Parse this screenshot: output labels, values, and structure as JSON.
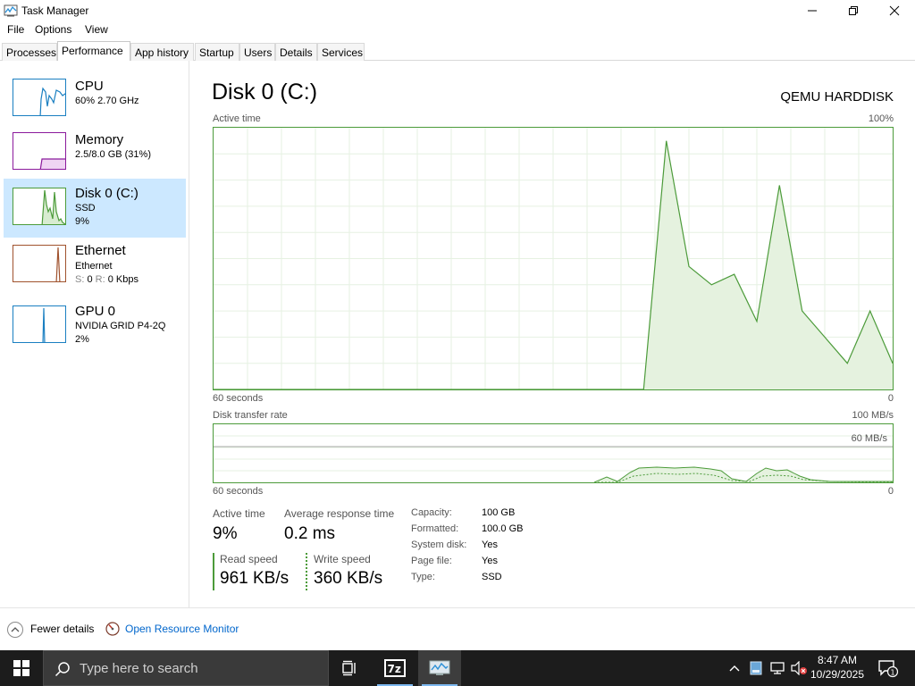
{
  "window": {
    "title": "Task Manager",
    "icon": "task-manager-icon"
  },
  "menu": [
    "File",
    "Options",
    "View"
  ],
  "tabs": [
    "Processes",
    "Performance",
    "App history",
    "Startup",
    "Users",
    "Details",
    "Services"
  ],
  "active_tab": "Performance",
  "sidebar": [
    {
      "name": "CPU",
      "sub1": "60% 2.70 GHz",
      "sub2": "",
      "color": "#1a7fc1"
    },
    {
      "name": "Memory",
      "sub1": "2.5/8.0 GB (31%)",
      "sub2": "",
      "color": "#8b1a9c"
    },
    {
      "name": "Disk 0 (C:)",
      "sub1": "SSD",
      "sub2": "9%",
      "color": "#4c9b3a"
    },
    {
      "name": "Ethernet",
      "sub1": "Ethernet",
      "sub2_dim": "S:",
      "sub2_a": " 0 ",
      "sub2_dim2": "R:",
      "sub2_b": " 0 Kbps",
      "color": "#a0522d"
    },
    {
      "name": "GPU 0",
      "sub1": "NVIDIA GRID P4-2Q",
      "sub2": "2%",
      "color": "#1a7fc1"
    }
  ],
  "selected_item": "Disk 0 (C:)",
  "main": {
    "title": "Disk 0 (C:)",
    "device": "QEMU HARDDISK",
    "graph1_label": "Active time",
    "graph1_max": "100%",
    "graph1_time": "60 seconds",
    "graph1_min": "0",
    "graph2_label": "Disk transfer rate",
    "graph2_max": "100 MB/s",
    "graph2_mid": "60 MB/s",
    "graph2_time": "60 seconds",
    "graph2_min": "0"
  },
  "stats": {
    "active_time_label": "Active time",
    "active_time_value": "9%",
    "avg_resp_label": "Average response time",
    "avg_resp_value": "0.2 ms",
    "read_label": "Read speed",
    "read_value": "961 KB/s",
    "write_label": "Write speed",
    "write_value": "360 KB/s"
  },
  "info": [
    {
      "k": "Capacity:",
      "v": "100 GB"
    },
    {
      "k": "Formatted:",
      "v": "100.0 GB"
    },
    {
      "k": "System disk:",
      "v": "Yes"
    },
    {
      "k": "Page file:",
      "v": "Yes"
    },
    {
      "k": "Type:",
      "v": "SSD"
    }
  ],
  "footer": {
    "fewer": "Fewer details",
    "resource_monitor": "Open Resource Monitor"
  },
  "taskbar": {
    "search_placeholder": "Type here to search",
    "time": "8:47 AM",
    "date": "10/29/2025",
    "notification_count": "1"
  },
  "chart_data": {
    "type": "area",
    "title": "Active time",
    "x": [
      60,
      58,
      56,
      54,
      52,
      50,
      48,
      46,
      44,
      42,
      40,
      38,
      36,
      34,
      32,
      30,
      28,
      26,
      24,
      22,
      20,
      18,
      16,
      14,
      12,
      10,
      8,
      6,
      4,
      2,
      0
    ],
    "series": [
      {
        "name": "Active time",
        "values": [
          0,
          0,
          0,
          0,
          0,
          0,
          0,
          0,
          0,
          0,
          0,
          0,
          0,
          0,
          0,
          0,
          0,
          0,
          0,
          0,
          95,
          47,
          40,
          44,
          26,
          78,
          30,
          20,
          10,
          30,
          10
        ]
      }
    ],
    "xlabel": "60 seconds",
    "ylim": [
      0,
      100
    ]
  }
}
